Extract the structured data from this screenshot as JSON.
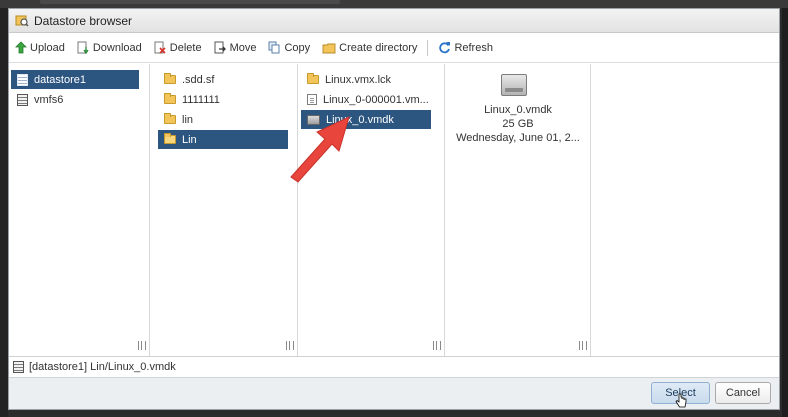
{
  "window": {
    "title": "Datastore browser"
  },
  "toolbar": {
    "upload": "Upload",
    "download": "Download",
    "delete": "Delete",
    "move": "Move",
    "copy": "Copy",
    "create_directory": "Create directory",
    "refresh": "Refresh"
  },
  "columns": {
    "datastores": [
      {
        "label": "datastore1",
        "selected": true,
        "icon": "datastore-icon"
      },
      {
        "label": "vmfs6",
        "selected": false,
        "icon": "datastore-icon"
      }
    ],
    "folders": [
      {
        "label": ".sdd.sf",
        "selected": false,
        "icon": "folder-icon"
      },
      {
        "label": "1111111",
        "selected": false,
        "icon": "folder-icon"
      },
      {
        "label": "lin",
        "selected": false,
        "icon": "folder-icon"
      },
      {
        "label": "Lin",
        "selected": true,
        "icon": "folder-open-icon"
      }
    ],
    "files": [
      {
        "label": "Linux.vmx.lck",
        "selected": false,
        "icon": "folder-icon"
      },
      {
        "label": "Linux_0-000001.vm...",
        "selected": false,
        "icon": "file-icon"
      },
      {
        "label": "Linux_0.vmdk",
        "selected": true,
        "icon": "disk-icon"
      }
    ]
  },
  "preview": {
    "name": "Linux_0.vmdk",
    "size": "25 GB",
    "modified": "Wednesday, June 01, 2..."
  },
  "path": {
    "text": "[datastore1] Lin/Linux_0.vmdk"
  },
  "buttons": {
    "select": "Select",
    "cancel": "Cancel"
  },
  "colors": {
    "selection": "#2c5580",
    "arrow": "#e8453c",
    "select_button": "#c9dbed"
  }
}
